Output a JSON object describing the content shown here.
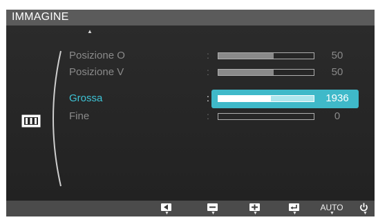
{
  "menu": {
    "title": "IMMAGINE",
    "scroll_indicator": "▲",
    "category_icon": "picture-size-icon"
  },
  "rows": [
    {
      "label": "Posizione O",
      "value": "50",
      "level": 0.58,
      "selected": false
    },
    {
      "label": "Posizione V",
      "value": "50",
      "level": 0.58,
      "selected": false
    },
    {
      "label": "Grossa",
      "value": "1936",
      "level": 0.55,
      "selected": true
    },
    {
      "label": "Fine",
      "value": "0",
      "level": 0.0,
      "selected": false
    }
  ],
  "separator": ":",
  "footer": {
    "buttons": [
      {
        "name": "left-arrow-button",
        "icon": "left-arrow-icon"
      },
      {
        "name": "minus-button",
        "icon": "minus-icon"
      },
      {
        "name": "plus-button",
        "icon": "plus-icon"
      },
      {
        "name": "enter-button",
        "icon": "enter-icon"
      },
      {
        "name": "auto-button",
        "label": "AUTO"
      },
      {
        "name": "power-button",
        "icon": "power-icon"
      }
    ],
    "down_marker": "▼"
  },
  "colors": {
    "accent": "#3fb9c9",
    "selected_label": "#3ec4d6",
    "background": "#262626"
  }
}
